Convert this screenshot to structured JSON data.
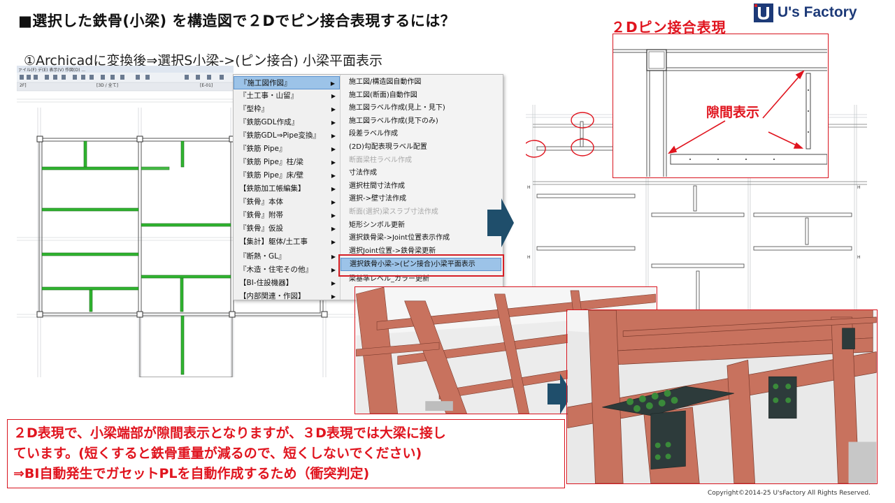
{
  "title": "■選択した鉄骨(小梁) を構造図で２Dでピン接合表現するには？",
  "subtitle": "①Archicadに変換後⇒選択S小梁->(ピン接合) 小梁平面表示",
  "logo": {
    "text": "U's Factory",
    "mark_color": "#1d3a78",
    "accent_color": "#d51f26"
  },
  "plan_left": {
    "toolbar_menu": "ァイル(F) デ(E) 表示(V) 作図(D) ...",
    "tab_floor": "2F]",
    "tab_3d": "[3D / 全て]",
    "tab_elev": "[E-01]"
  },
  "menu": {
    "left_items": [
      {
        "label": "『施工図作図』",
        "selected": true
      },
      {
        "label": "『土工事・山留』",
        "selected": false
      },
      {
        "label": "『型枠』",
        "selected": false
      },
      {
        "label": "『鉄筋GDL作成』",
        "selected": false
      },
      {
        "label": "『鉄筋GDL⇒Pipe変換』",
        "selected": false
      },
      {
        "label": "『鉄筋 Pipe』",
        "selected": false
      },
      {
        "label": "『鉄筋 Pipe』柱/梁",
        "selected": false
      },
      {
        "label": "『鉄筋 Pipe』床/壁",
        "selected": false
      },
      {
        "label": "【鉄筋加工帳編集】",
        "selected": false
      },
      {
        "label": "『鉄骨』本体",
        "selected": false
      },
      {
        "label": "『鉄骨』附帯",
        "selected": false
      },
      {
        "label": "『鉄骨』仮設",
        "selected": false
      },
      {
        "label": "【集計】躯体/土工事",
        "selected": false
      },
      {
        "label": "『断熱・GL』",
        "selected": false
      },
      {
        "label": "『木造・住宅その他』",
        "selected": false
      },
      {
        "label": "【BI-住設機器】",
        "selected": false
      },
      {
        "label": "【内部関連・作図】",
        "selected": false
      }
    ],
    "right_items": [
      {
        "label": "施工図/構造図自動作図",
        "disabled": false,
        "selected": false
      },
      {
        "label": "施工図(断面)自動作図",
        "disabled": false,
        "selected": false
      },
      {
        "label": "施工図ラベル作成(見上・見下)",
        "disabled": false,
        "selected": false
      },
      {
        "label": "施工図ラベル作成(見下のみ)",
        "disabled": false,
        "selected": false
      },
      {
        "label": "段差ラベル作成",
        "disabled": false,
        "selected": false
      },
      {
        "label": "(2D)勾配表現ラベル配置",
        "disabled": false,
        "selected": false
      },
      {
        "label": "断面梁柱ラベル作成",
        "disabled": true,
        "selected": false
      },
      {
        "label": "寸法作成",
        "disabled": false,
        "selected": false
      },
      {
        "label": "選択柱間寸法作成",
        "disabled": false,
        "selected": false
      },
      {
        "label": "選択->壁寸法作成",
        "disabled": false,
        "selected": false
      },
      {
        "label": "断面(選択)梁スラブ寸法作成",
        "disabled": true,
        "selected": false
      },
      {
        "label": "矩形シンボル更新",
        "disabled": false,
        "selected": false
      },
      {
        "label": "選択鉄骨梁->Joint位置表示作成",
        "disabled": false,
        "selected": false
      },
      {
        "label": "選択Joint位置->鉄骨梁更新",
        "disabled": false,
        "selected": false
      },
      {
        "label": "選択鉄骨小梁->(ピン接合)小梁平面表示",
        "disabled": false,
        "selected": true
      },
      {
        "label": "梁基準レベル_カラー更新",
        "disabled": false,
        "selected": false
      }
    ]
  },
  "detail": {
    "label": "２Dピン接合表現",
    "gap_label": "隙間表示"
  },
  "note": {
    "lines": [
      "２D表現で、小梁端部が隙間表示となりますが、３D表現では大梁に接し",
      "ています。(短くすると鉄骨重量が減るので、短くしないでください)",
      "⇒BI自動発生でガセットPLを自動作成するため（衝突判定)"
    ]
  },
  "copyright": "Copyright©2014-25  U'sFactory All Rights Reserved.",
  "colors": {
    "highlight_red": "#e0141e",
    "beam_green": "#2fb52f",
    "arrow_blue": "#1f4e6b",
    "steel_salmon": "#c8725e",
    "menu_select": "#9cc3e8"
  }
}
